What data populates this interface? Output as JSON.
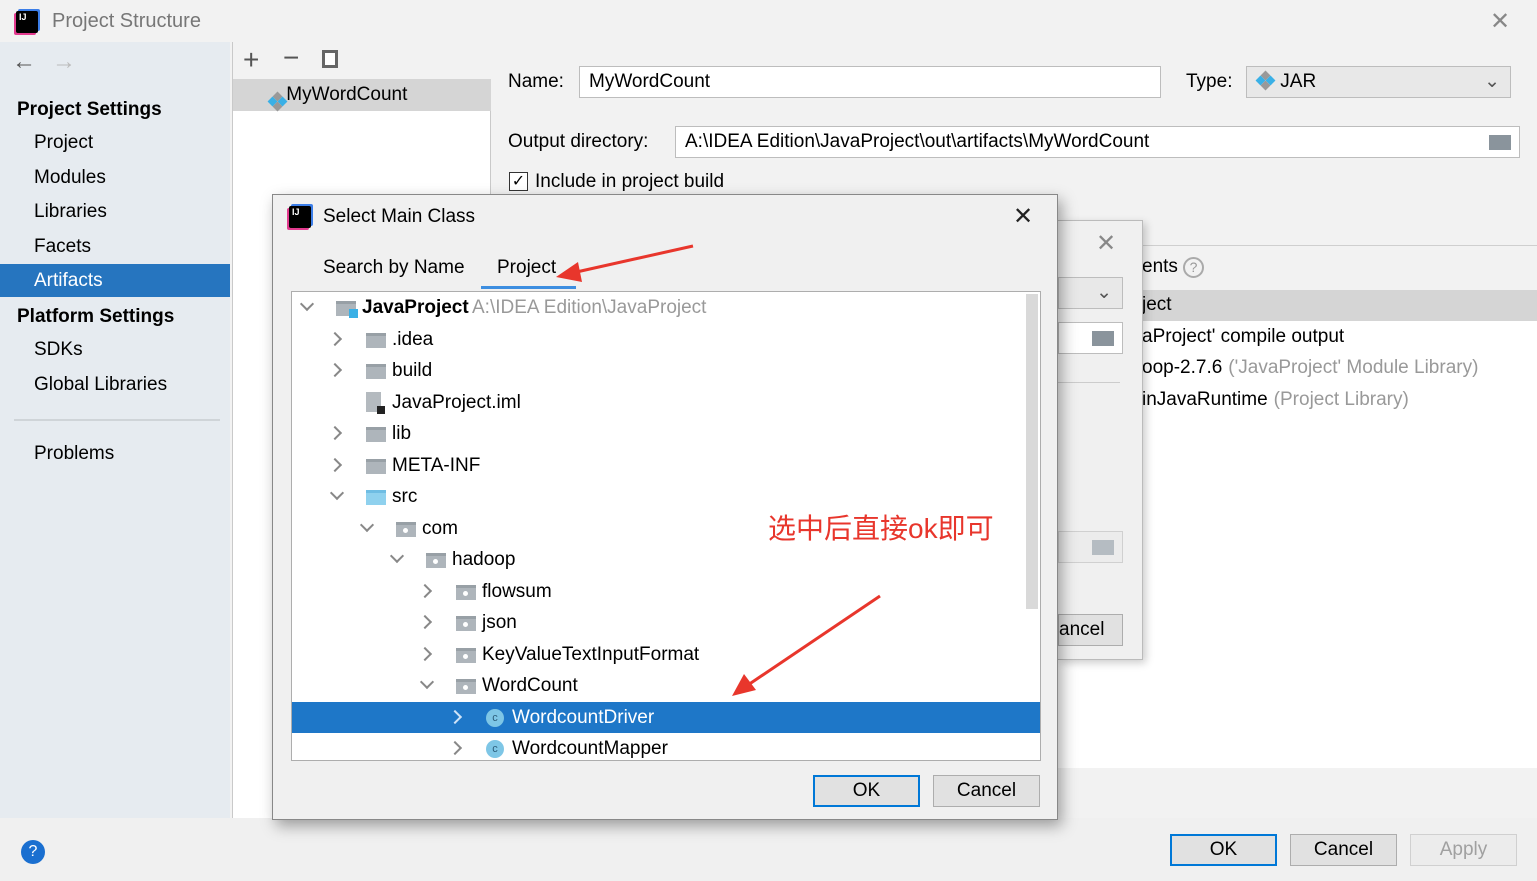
{
  "window": {
    "title": "Project Structure"
  },
  "sidebar": {
    "section1": "Project Settings",
    "items1": [
      "Project",
      "Modules",
      "Libraries",
      "Facets",
      "Artifacts"
    ],
    "selected": "Artifacts",
    "section2": "Platform Settings",
    "items2": [
      "SDKs",
      "Global Libraries"
    ],
    "problems": "Problems"
  },
  "artifacts": {
    "list": [
      "MyWordCount"
    ]
  },
  "form": {
    "name_label": "Name:",
    "name_value": "MyWordCount",
    "type_label": "Type:",
    "type_value": "JAR",
    "output_label": "Output directory:",
    "output_value": "A:\\IDEA Edition\\JavaProject\\out\\artifacts\\MyWordCount",
    "include_label": "Include in project build",
    "include_checked": true,
    "elements_label": "ents",
    "elements": [
      {
        "main": "ject",
        "sub": ""
      },
      {
        "main": "aProject' compile output",
        "sub": ""
      },
      {
        "main": "oop-2.7.6",
        "sub": "('JavaProject' Module Library)"
      },
      {
        "main": "inJavaRuntime",
        "sub": "(Project Library)"
      }
    ]
  },
  "bg_dialog": {
    "cancel": "ancel"
  },
  "footer": {
    "ok": "OK",
    "cancel": "Cancel",
    "apply": "Apply"
  },
  "dialog": {
    "title": "Select Main Class",
    "tabs": [
      "Search by Name",
      "Project"
    ],
    "active_tab": "Project",
    "tree": [
      {
        "level": 0,
        "label": "JavaProject",
        "hint": "A:\\IDEA Edition\\JavaProject",
        "icon": "project-folder",
        "exp": "down",
        "bold": true
      },
      {
        "level": 1,
        "label": ".idea",
        "icon": "folder",
        "exp": "right"
      },
      {
        "level": 1,
        "label": "build",
        "icon": "folder",
        "exp": "right"
      },
      {
        "level": 1,
        "label": "JavaProject.iml",
        "icon": "file",
        "exp": ""
      },
      {
        "level": 1,
        "label": "lib",
        "icon": "folder",
        "exp": "right"
      },
      {
        "level": 1,
        "label": "META-INF",
        "icon": "folder",
        "exp": "right"
      },
      {
        "level": 1,
        "label": "src",
        "icon": "source-folder",
        "exp": "down"
      },
      {
        "level": 2,
        "label": "com",
        "icon": "package",
        "exp": "down"
      },
      {
        "level": 3,
        "label": "hadoop",
        "icon": "package",
        "exp": "down"
      },
      {
        "level": 4,
        "label": "flowsum",
        "icon": "package",
        "exp": "right"
      },
      {
        "level": 4,
        "label": "json",
        "icon": "package",
        "exp": "right"
      },
      {
        "level": 4,
        "label": "KeyValueTextInputFormat",
        "icon": "package",
        "exp": "right"
      },
      {
        "level": 4,
        "label": "WordCount",
        "icon": "package",
        "exp": "down"
      },
      {
        "level": 5,
        "label": "WordcountDriver",
        "icon": "class",
        "exp": "right",
        "selected": true
      },
      {
        "level": 5,
        "label": "WordcountMapper",
        "icon": "class",
        "exp": "right"
      }
    ],
    "ok": "OK",
    "cancel": "Cancel"
  },
  "annotation": {
    "text": "选中后直接ok即可",
    "color": "#e8362c"
  },
  "colors": {
    "selection": "#2675bf",
    "tree_selection": "#1e77c8",
    "accent": "#0078d7"
  }
}
